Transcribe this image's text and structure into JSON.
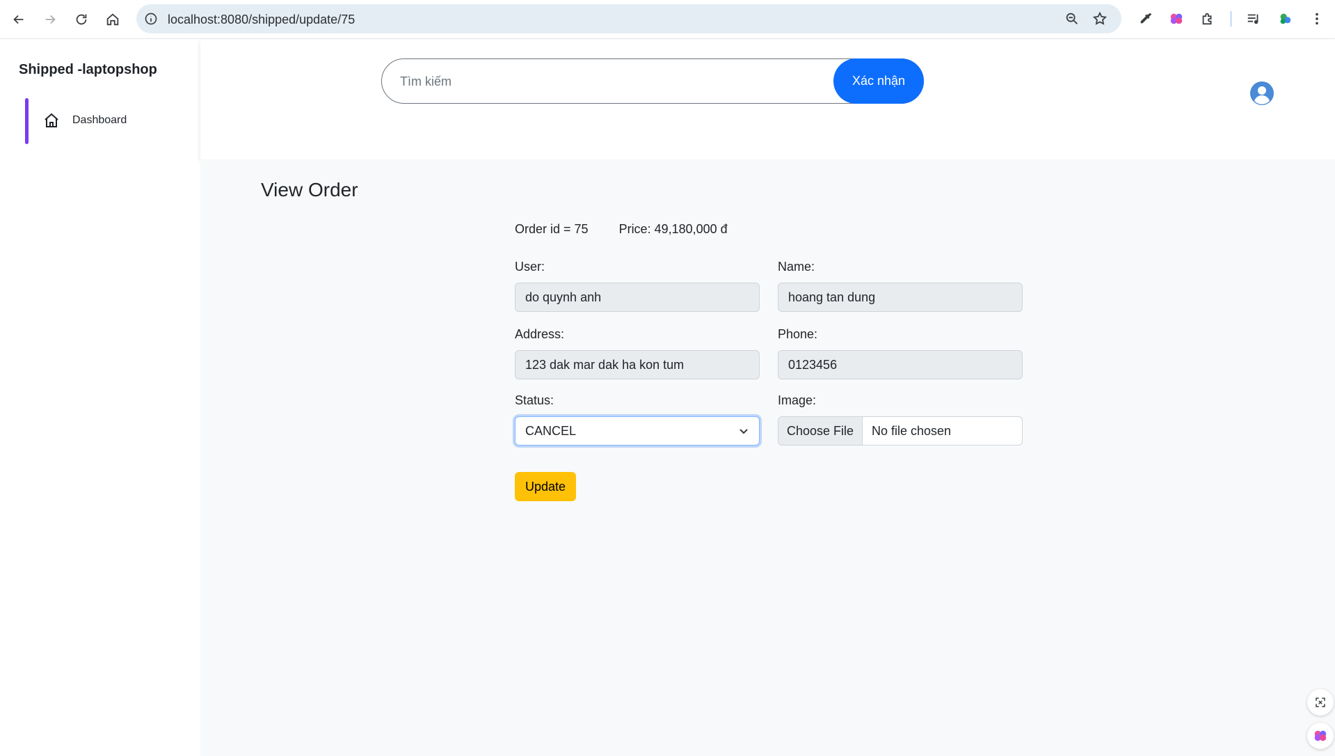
{
  "browser": {
    "url": "localhost:8080/shipped/update/75"
  },
  "sidebar": {
    "brand": "Shipped -laptopshop",
    "items": [
      {
        "label": "Dashboard",
        "icon": "home-icon"
      }
    ],
    "accent_color": "#7c3aed"
  },
  "header": {
    "search_placeholder": "Tìm kiếm",
    "search_button": "Xác nhận",
    "user_icon": "user-circle-icon"
  },
  "main": {
    "title": "View Order",
    "order_id": "Order id = 75",
    "price": "Price: 49,180,000 đ",
    "user_label": "User:",
    "user_value": "do quynh anh",
    "name_label": "Name:",
    "name_value": "hoang tan dung",
    "address_label": "Address:",
    "address_value": "123 dak mar dak ha kon tum",
    "phone_label": "Phone:",
    "phone_value": "0123456",
    "status_label": "Status:",
    "status_value": "CANCEL",
    "image_label": "Image:",
    "file_button": "Choose File",
    "file_status": "No file chosen",
    "update_button": "Update"
  },
  "colors": {
    "primary": "#0d6efd",
    "warning": "#ffc107",
    "user_icon": "#4a8ad6"
  }
}
